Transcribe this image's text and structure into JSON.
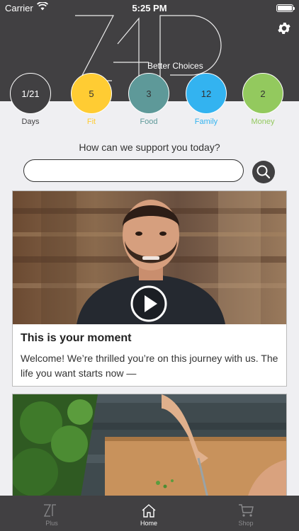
{
  "status": {
    "carrier": "Carrier",
    "time": "5:25 PM"
  },
  "header": {
    "tagline": "Better Choices"
  },
  "stats": [
    {
      "value": "1/21",
      "label": "Days",
      "color": "#414042",
      "text_color": "#ffffff",
      "label_color": "#414042"
    },
    {
      "value": "5",
      "label": "Fit",
      "color": "#ffcc33",
      "text_color": "#333333",
      "label_color": "#ffcc33"
    },
    {
      "value": "3",
      "label": "Food",
      "color": "#5e9999",
      "text_color": "#333333",
      "label_color": "#5e9999"
    },
    {
      "value": "12",
      "label": "Family",
      "color": "#33b3f0",
      "text_color": "#333333",
      "label_color": "#33b3f0"
    },
    {
      "value": "2",
      "label": "Money",
      "color": "#93c95e",
      "text_color": "#333333",
      "label_color": "#93c95e"
    }
  ],
  "search": {
    "question": "How can we support you today?",
    "value": "",
    "placeholder": ""
  },
  "cards": [
    {
      "title": "This is your moment",
      "text": "Welcome! We’re thrilled you’re on this journey with us. The life you want starts now —"
    }
  ],
  "tabs": [
    {
      "label": "Plus",
      "icon": "zp-logo-icon",
      "active": false
    },
    {
      "label": "Home",
      "icon": "home-icon",
      "active": true
    },
    {
      "label": "Shop",
      "icon": "cart-icon",
      "active": false
    }
  ],
  "colors": {
    "header": "#414042",
    "tab_active": "#ffffff",
    "tab_inactive": "#8a8a8c"
  }
}
